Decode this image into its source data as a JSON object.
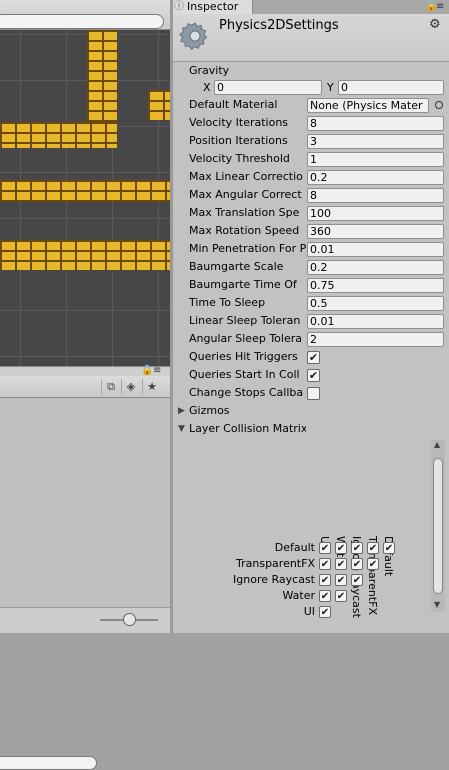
{
  "inspector": {
    "tab_label": "Inspector",
    "title": "Physics2DSettings"
  },
  "gravity": {
    "label": "Gravity",
    "x_label": "X",
    "x_value": "0",
    "y_label": "Y",
    "y_value": "0"
  },
  "fields": [
    {
      "label": "Default Material",
      "value": "None (Physics Mater"
    },
    {
      "label": "Velocity Iterations",
      "value": "8"
    },
    {
      "label": "Position Iterations",
      "value": "3"
    },
    {
      "label": "Velocity Threshold",
      "value": "1"
    },
    {
      "label": "Max Linear Correctio",
      "value": "0.2"
    },
    {
      "label": "Max Angular Correct",
      "value": "8"
    },
    {
      "label": "Max Translation Spe",
      "value": "100"
    },
    {
      "label": "Max Rotation Speed",
      "value": "360"
    },
    {
      "label": "Min Penetration For P",
      "value": "0.01"
    },
    {
      "label": "Baumgarte Scale",
      "value": "0.2"
    },
    {
      "label": "Baumgarte Time Of",
      "value": "0.75"
    },
    {
      "label": "Time To Sleep",
      "value": "0.5"
    },
    {
      "label": "Linear Sleep Toleran",
      "value": "0.01"
    },
    {
      "label": "Angular Sleep Tolera",
      "value": "2"
    }
  ],
  "toggles": [
    {
      "label": "Queries Hit Triggers",
      "checked": true
    },
    {
      "label": "Queries Start In Coll",
      "checked": true
    },
    {
      "label": "Change Stops Callba",
      "checked": false
    }
  ],
  "gizmos": {
    "label": "Gizmos"
  },
  "matrix": {
    "label": "Layer Collision Matrix",
    "columns": [
      "UI",
      "Water",
      "Ignore Raycast",
      "TransparentFX",
      "Default"
    ],
    "rows": [
      "Default",
      "TransparentFX",
      "Ignore Raycast",
      "Water",
      "UI"
    ]
  }
}
